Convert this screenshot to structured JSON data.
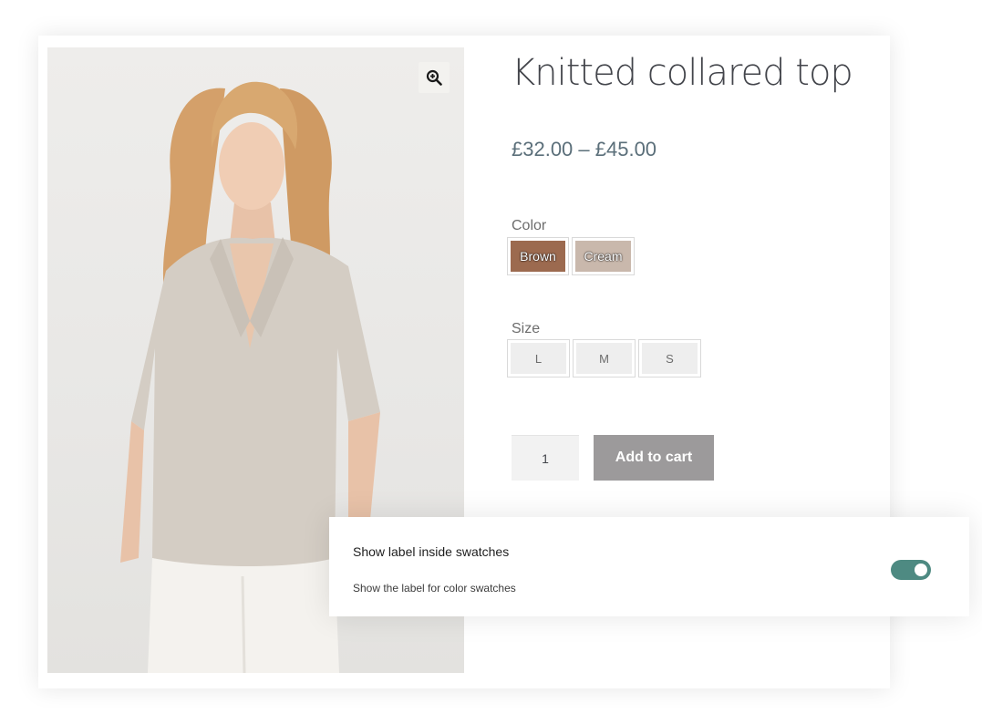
{
  "product": {
    "title": "Knitted collared top",
    "price": "£32.00 – £45.00",
    "quantity": "1",
    "add_to_cart_label": "Add to cart"
  },
  "attributes": {
    "color": {
      "label": "Color",
      "options": [
        {
          "label": "Brown",
          "color": "#9c6a4f"
        },
        {
          "label": "Cream",
          "color": "#c9b8ac"
        }
      ]
    },
    "size": {
      "label": "Size",
      "options": [
        {
          "label": "L"
        },
        {
          "label": "M"
        },
        {
          "label": "S"
        }
      ]
    }
  },
  "icons": {
    "zoom": "zoom-in-icon"
  },
  "settings": {
    "title": "Show label inside swatches",
    "description": "Show the label for color swatches",
    "toggle_on": true,
    "toggle_color": "#4e8a82"
  }
}
